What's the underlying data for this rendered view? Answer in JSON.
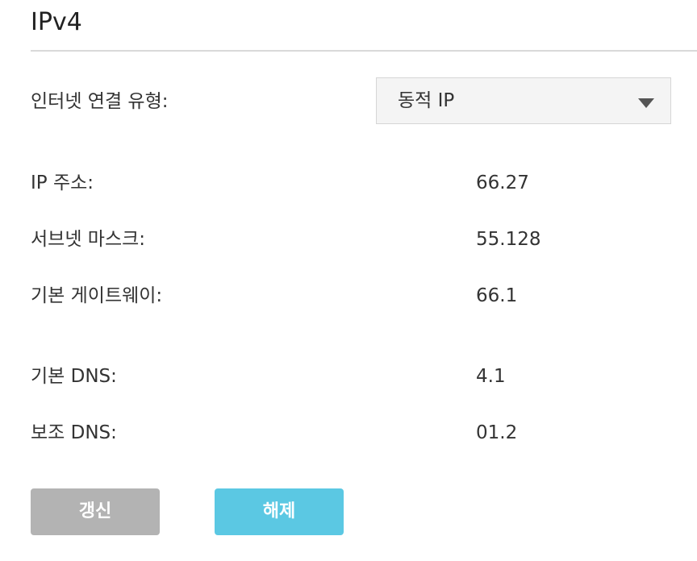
{
  "section": {
    "title": "IPv4"
  },
  "connection": {
    "label": "인터넷 연결 유형:",
    "selected": "동적 IP"
  },
  "fields": [
    {
      "label": "IP 주소:",
      "value": "66.27"
    },
    {
      "label": "서브넷 마스크:",
      "value": "55.128"
    },
    {
      "label": "기본 게이트웨이:",
      "value": "66.1"
    },
    {
      "label": "기본 DNS:",
      "value": "4.1"
    },
    {
      "label": "보조 DNS:",
      "value": "01.2"
    }
  ],
  "buttons": {
    "renew": "갱신",
    "release": "해제"
  },
  "colors": {
    "renew_bg": "#b3b3b3",
    "release_bg": "#5bc8e3"
  },
  "icons": {
    "dropdown": "triangle-down-icon"
  }
}
